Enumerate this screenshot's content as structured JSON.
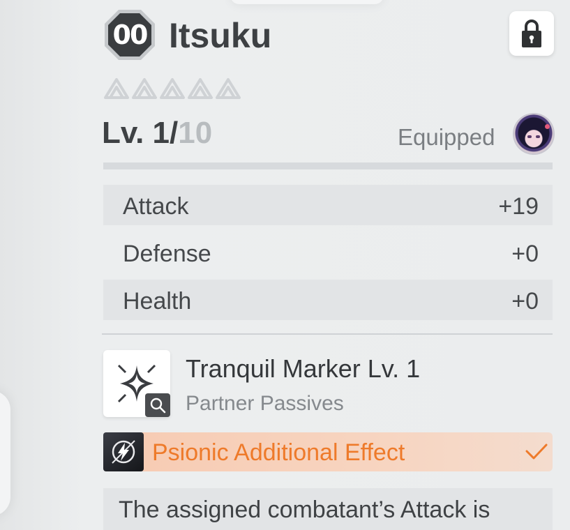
{
  "header": {
    "rarity_grade": "00",
    "name": "Itsuku",
    "stars_filled": 0,
    "stars_total": 5
  },
  "level": {
    "current": "Lv. 1/",
    "max": "10"
  },
  "equipped": {
    "label": "Equipped"
  },
  "stats": [
    {
      "name": "Attack",
      "value": "+19"
    },
    {
      "name": "Defense",
      "value": "+0"
    },
    {
      "name": "Health",
      "value": "+0"
    }
  ],
  "skill": {
    "name": "Tranquil Marker Lv. 1",
    "category": "Partner Passives"
  },
  "effect": {
    "label": "Psionic Additional Effect"
  },
  "description": {
    "text": "The assigned combatant’s Attack is"
  },
  "colors": {
    "accent_orange": "#ee7a2a",
    "effect_bar": "#f7ccb4",
    "badge_dark": "#3a3d40"
  },
  "icons": {
    "lock": "lock-icon",
    "sparkle": "sparkle-icon",
    "zoom": "magnifier-icon",
    "bolt": "lightning-icon",
    "check": "check-icon"
  }
}
